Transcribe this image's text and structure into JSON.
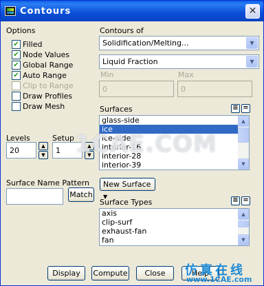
{
  "window": {
    "title": "Contours",
    "close_glyph": "✕"
  },
  "options": {
    "label": "Options",
    "checkboxes": [
      {
        "label": "Filled",
        "checked": true,
        "enabled": true
      },
      {
        "label": "Node Values",
        "checked": true,
        "enabled": true
      },
      {
        "label": "Global Range",
        "checked": true,
        "enabled": true
      },
      {
        "label": "Auto Range",
        "checked": true,
        "enabled": true
      },
      {
        "label": "Clip to Range",
        "checked": false,
        "enabled": false
      },
      {
        "label": "Draw Profiles",
        "checked": false,
        "enabled": true
      },
      {
        "label": "Draw Mesh",
        "checked": false,
        "enabled": true
      }
    ]
  },
  "contours_of": {
    "label": "Contours of",
    "category": "Solidification/Melting...",
    "quantity": "Liquid Fraction",
    "min_label": "Min",
    "max_label": "Max",
    "min_value": "0",
    "max_value": "0"
  },
  "surfaces": {
    "label": "Surfaces",
    "items": [
      "glass-side",
      "ice",
      "ice-side",
      "interior-16",
      "interior-28",
      "interior-39"
    ],
    "selected": "ice",
    "new_surface_label": "New Surface"
  },
  "levels": {
    "label": "Levels",
    "value": "20"
  },
  "setup": {
    "label": "Setup",
    "value": "1"
  },
  "surface_name_pattern": {
    "label": "Surface Name Pattern",
    "value": "",
    "match_label": "Match"
  },
  "surface_types": {
    "label": "Surface Types",
    "items": [
      "axis",
      "clip-surf",
      "exhaust-fan",
      "fan"
    ]
  },
  "buttons": {
    "display": "Display",
    "compute": "Compute",
    "close": "Close",
    "help": "Help"
  },
  "watermark": {
    "text": "1CAE.COM",
    "brand_cn": "仿真在线",
    "brand_url": "www.1CAE.com"
  },
  "colors": {
    "title_bar": "#0a4fd6",
    "selection": "#316ac5",
    "dialog_bg": "#ece9d8"
  }
}
